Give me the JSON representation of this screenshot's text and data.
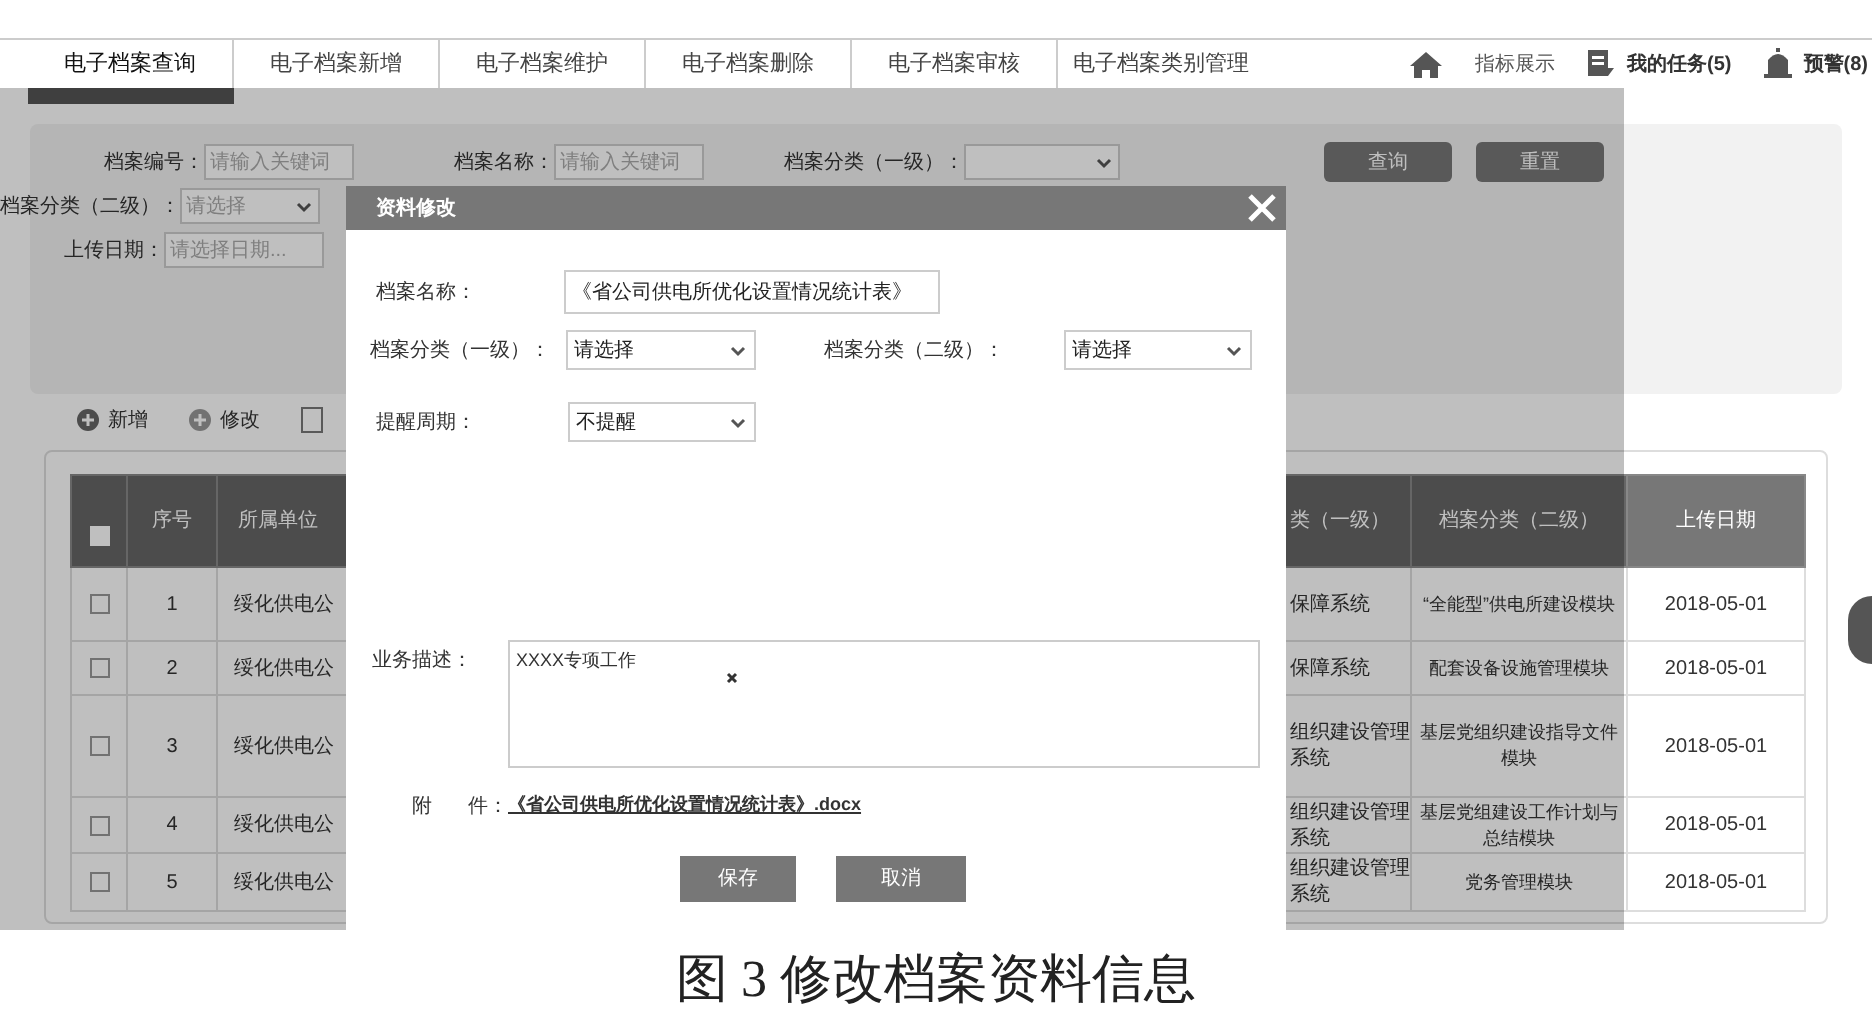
{
  "nav": {
    "tabs": [
      {
        "label": "电子档案查询",
        "selected": true
      },
      {
        "label": "电子档案新增",
        "selected": false
      },
      {
        "label": "电子档案维护",
        "selected": false
      },
      {
        "label": "电子档案删除",
        "selected": false
      },
      {
        "label": "电子档案审核",
        "selected": false
      },
      {
        "label": "电子档案类别管理",
        "selected": false
      }
    ],
    "links": [
      {
        "kind": "home",
        "label": "指标展示"
      },
      {
        "kind": "task",
        "label": "我的任务(5)"
      },
      {
        "kind": "alert",
        "label": "预警(8)"
      }
    ]
  },
  "search": {
    "row_1": [
      {
        "kind": "text",
        "label": "档案编号：",
        "placeholder": "请输入关键词"
      },
      {
        "kind": "text",
        "label": "档案名称：",
        "placeholder": "请输入关键词"
      },
      {
        "kind": "select",
        "label": "档案分类（一级）："
      }
    ],
    "row_2": [
      {
        "kind": "select",
        "label": "档案分类（二级）：",
        "placeholder": "请选择"
      }
    ],
    "row_3": [
      {
        "kind": "text",
        "label": "上传日期：",
        "placeholder": "请选择日期..."
      }
    ],
    "buttons": [
      "查询",
      "重置"
    ]
  },
  "toolbar": [
    {
      "kind": "add",
      "label": "新增"
    },
    {
      "kind": "edit",
      "label": "修改"
    }
  ],
  "table": {
    "header_checkbox": {
      "checked": false
    },
    "columns": [
      "序号",
      "所属单位",
      "类（一级）",
      "档案分类（二级）",
      "上传日期"
    ],
    "rows": [
      {
        "checked": false,
        "cells": [
          "1",
          "绥化供电公",
          "保障系统",
          "“全能型”供电所建设模块",
          "2018-05-01"
        ]
      },
      {
        "checked": false,
        "cells": [
          "2",
          "绥化供电公",
          "保障系统",
          "配套设备设施管理模块",
          "2018-05-01"
        ]
      },
      {
        "checked": false,
        "cells": [
          "3",
          "绥化供电公",
          "组织建设管理系统",
          "基层党组织建设指导文件模块",
          "2018-05-01"
        ]
      },
      {
        "checked": false,
        "cells": [
          "4",
          "绥化供电公",
          "组织建设管理系统",
          "基层党组建设工作计划与总结模块",
          "2018-05-01"
        ]
      },
      {
        "checked": false,
        "cells": [
          "5",
          "绥化供电公",
          "组织建设管理系统",
          "党务管理模块",
          "2018-05-01"
        ]
      }
    ]
  },
  "dialog": {
    "title": "资料修改",
    "name": {
      "label": "档案名称：",
      "value": "《省公司供电所优化设置情况统计表》"
    },
    "category_1": {
      "label": "档案分类（一级）：",
      "value": "请选择"
    },
    "category_2": {
      "label": "档案分类（二级）：",
      "value": "请选择"
    },
    "reminder": {
      "label": "提醒周期：",
      "value": "不提醒"
    },
    "description": {
      "label": "业务描述：",
      "value": "XXXX专项工作"
    },
    "attachment": {
      "label_1": "附",
      "label_2": "件：",
      "file": "《省公司供电所优化设置情况统计表》.docx"
    },
    "buttons": [
      "保存",
      "取消"
    ]
  },
  "caption": "图 3 修改档案资料信息"
}
